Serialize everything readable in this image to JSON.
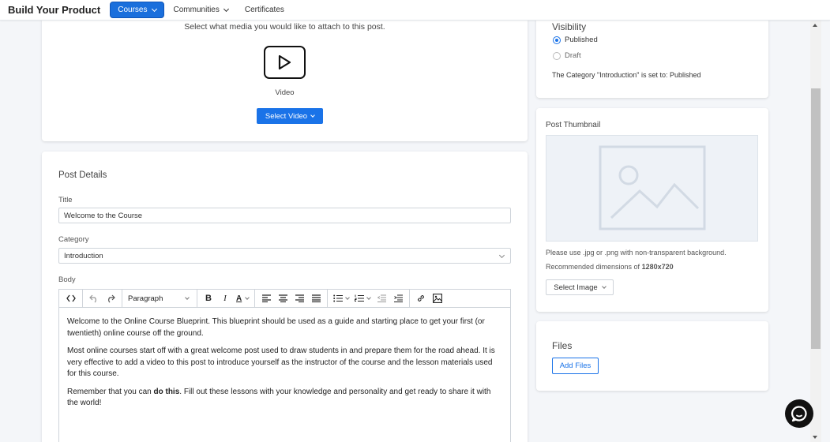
{
  "nav": {
    "brand": "Build Your Product",
    "items": [
      {
        "label": "Courses"
      },
      {
        "label": "Communities"
      },
      {
        "label": "Certificates"
      }
    ]
  },
  "media": {
    "prompt": "Select what media you would like to attach to this post.",
    "video_label": "Video",
    "select_video": "Select Video"
  },
  "details": {
    "title": "Post Details",
    "title_label": "Title",
    "title_value": "Welcome to the Course",
    "category_label": "Category",
    "category_value": "Introduction",
    "body_label": "Body",
    "toolbar_format": "Paragraph",
    "body": {
      "p1": "Welcome to the Online Course Blueprint. This blueprint should be used as a guide and starting place to get your first (or twentieth) online course off the ground.",
      "p2": "Most online courses start off with a great welcome post used to draw students in and prepare them for the road ahead. It is very effective to add a video to this post to introduce yourself as the instructor of the course and the lesson materials used for this course.",
      "p3_before": "Remember that you can ",
      "p3_bold": "do this",
      "p3_after": ". Fill out these lessons with your knowledge and personality and get ready to share it with the world!"
    }
  },
  "visibility": {
    "title": "Visibility",
    "published": "Published",
    "draft": "Draft",
    "selected": "Published",
    "note": "The Category \"Introduction\" is set to: Published"
  },
  "thumbnail": {
    "title": "Post Thumbnail",
    "note1": "Please use .jpg or .png with non-transparent background.",
    "note2_prefix": "Recommended dimensions of ",
    "note2_bold": "1280x720",
    "select_image": "Select Image"
  },
  "files": {
    "title": "Files",
    "add_files": "Add Files"
  },
  "colors": {
    "accent": "#1a73e8",
    "nav_active": "#1a6fdc",
    "background": "#f4f6f9"
  }
}
